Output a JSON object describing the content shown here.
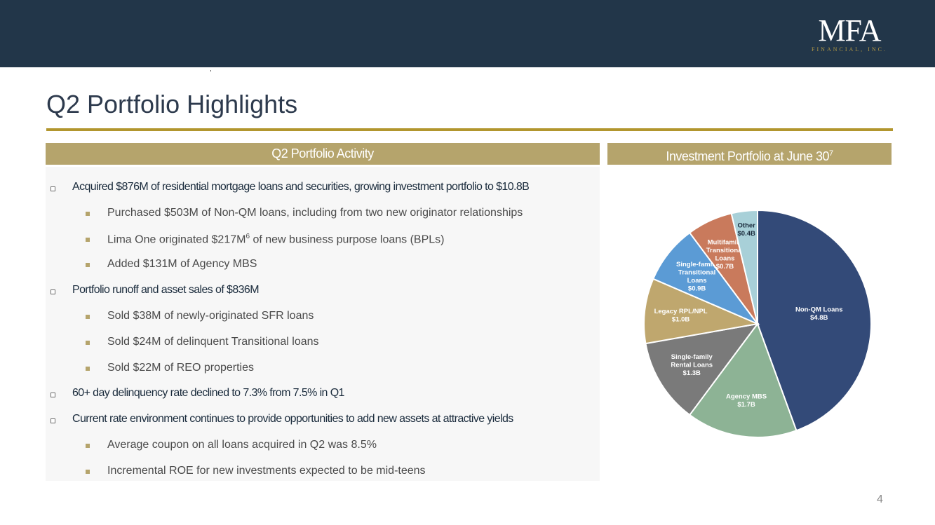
{
  "header": {
    "logo_main": "MFA",
    "logo_sub": "FINANCIAL, INC."
  },
  "page": {
    "title": "Q2 Portfolio Highlights",
    "page_number": "4"
  },
  "left_section": {
    "heading": "Q2 Portfolio Activity",
    "items": [
      {
        "level": 1,
        "text": "Acquired $876M of residential mortgage loans and securities, growing investment portfolio to $10.8B"
      },
      {
        "level": 2,
        "text": "Purchased $503M of Non-QM loans, including from two new originator relationships"
      },
      {
        "level": 2,
        "text": "Lima One originated $217M",
        "sup": "6",
        "text_after": " of new business purpose loans (BPLs)"
      },
      {
        "level": 2,
        "text": "Added $131M of Agency MBS"
      },
      {
        "level": 1,
        "text": "Portfolio runoff and asset sales of $836M"
      },
      {
        "level": 2,
        "text": "Sold $38M of newly-originated SFR loans"
      },
      {
        "level": 2,
        "text": "Sold $24M of delinquent Transitional loans"
      },
      {
        "level": 2,
        "text": "Sold $22M of REO properties"
      },
      {
        "level": 1,
        "text": "60+ day delinquency rate declined to 7.3% from 7.5% in Q1"
      },
      {
        "level": 1,
        "text": "Current rate environment continues to provide opportunities to add new assets at attractive yields"
      },
      {
        "level": 2,
        "text": "Average coupon on all loans acquired in Q2 was 8.5%"
      },
      {
        "level": 2,
        "text": "Incremental ROE for new investments expected to be mid-teens"
      }
    ]
  },
  "right_section": {
    "heading": "Investment Portfolio at June 30",
    "heading_sup": "7"
  },
  "chart_data": {
    "type": "pie",
    "title": "Investment Portfolio at June 30",
    "unit": "$B",
    "start_angle_deg": 0,
    "direction": "clockwise",
    "slices": [
      {
        "label_lines": [
          "Non-QM Loans",
          "$4.8B"
        ],
        "value": 4.8,
        "color": "#334a78",
        "label_color": "#ffffff"
      },
      {
        "label_lines": [
          "Agency MBS",
          "$1.7B"
        ],
        "value": 1.7,
        "color": "#8db395",
        "label_color": "#ffffff"
      },
      {
        "label_lines": [
          "Single-family",
          "Rental Loans",
          "$1.3B"
        ],
        "value": 1.3,
        "color": "#7a7a7a",
        "label_color": "#ffffff"
      },
      {
        "label_lines": [
          "Legacy RPL/NPL",
          "$1.0B"
        ],
        "value": 1.0,
        "color": "#bfa76e",
        "label_color": "#ffffff"
      },
      {
        "label_lines": [
          "Single-family",
          "Transitional",
          "Loans",
          "$0.9B"
        ],
        "value": 0.9,
        "color": "#5b9bd5",
        "label_color": "#ffffff"
      },
      {
        "label_lines": [
          "Multifamily",
          "Transitional",
          "Loans",
          "$0.7B"
        ],
        "value": 0.7,
        "color": "#c97a5c",
        "label_color": "#ffffff"
      },
      {
        "label_lines": [
          "Other",
          "$0.4B"
        ],
        "value": 0.4,
        "color": "#a8d0d8",
        "label_color": "#1a2b3c"
      }
    ]
  }
}
